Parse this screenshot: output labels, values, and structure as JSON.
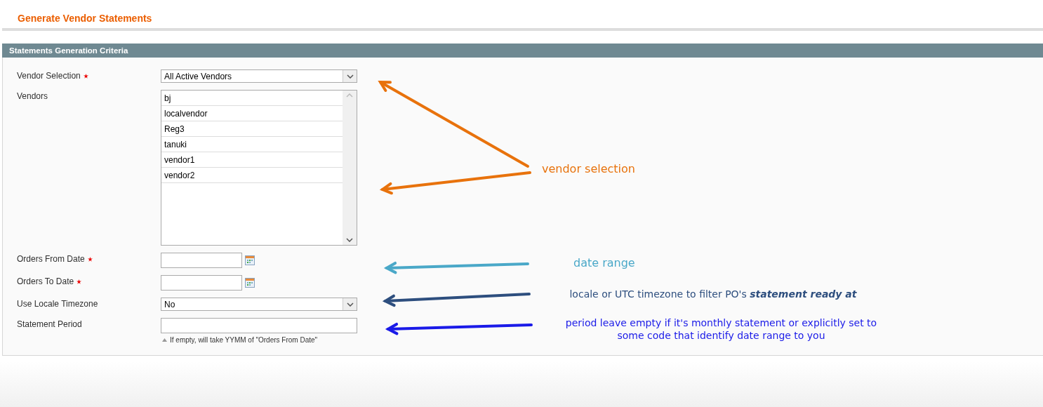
{
  "page": {
    "title": "Generate Vendor Statements"
  },
  "section": {
    "title": "Statements Generation Criteria"
  },
  "fields": [
    {
      "kind": "select",
      "label": "Vendor Selection",
      "required": true,
      "value": "All Active Vendors"
    },
    {
      "kind": "listbox",
      "label": "Vendors",
      "required": false,
      "options": [
        "bj",
        "localvendor",
        "Reg3",
        "tanuki",
        "vendor1",
        "vendor2"
      ]
    },
    {
      "kind": "date",
      "label": "Orders From Date",
      "required": true
    },
    {
      "kind": "date",
      "label": "Orders To Date",
      "required": true
    },
    {
      "kind": "select",
      "label": "Use Locale Timezone",
      "required": false,
      "value": "No"
    },
    {
      "kind": "text",
      "label": "Statement Period",
      "required": false,
      "hint": "If empty, will take YYMM of \"Orders From Date\""
    }
  ],
  "annotations": [
    {
      "text": "vendor selection",
      "color": "#e8720c"
    },
    {
      "text": "date range",
      "color": "#4aa8c8"
    },
    {
      "text": "locale or UTC timezone to filter PO's **statement ready at**",
      "color": "#2d4e7e"
    },
    {
      "text": "period leave empty if it's monthly statement or explicitly set to some code that identify date range to you",
      "color": "#1a1ae8"
    }
  ]
}
